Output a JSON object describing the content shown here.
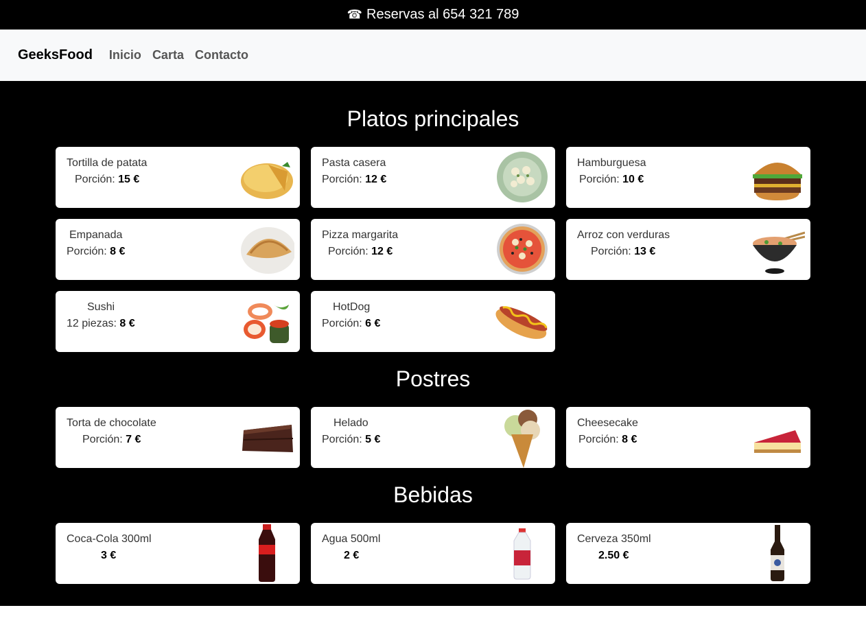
{
  "topbar": {
    "phone_icon": "☎",
    "text": "Reservas al 654 321 789"
  },
  "nav": {
    "brand": "GeeksFood",
    "links": [
      "Inicio",
      "Carta",
      "Contacto"
    ]
  },
  "sections": [
    {
      "title": "Platos principales",
      "items": [
        {
          "name": "Tortilla de patata",
          "price_label": "Porción:",
          "price": "15 €",
          "icon": "tortilla-image"
        },
        {
          "name": "Pasta casera",
          "price_label": "Porción:",
          "price": "12 €",
          "icon": "pasta-image"
        },
        {
          "name": "Hamburguesa",
          "price_label": "Porción:",
          "price": "10 €",
          "icon": "burger-image"
        },
        {
          "name": "Empanada",
          "price_label": "Porción:",
          "price": "8 €",
          "icon": "empanada-image"
        },
        {
          "name": "Pizza margarita",
          "price_label": "Porción:",
          "price": "12 €",
          "icon": "pizza-image"
        },
        {
          "name": "Arroz con verduras",
          "price_label": "Porción:",
          "price": "13 €",
          "icon": "rice-image"
        },
        {
          "name": "Sushi",
          "price_label": "12 piezas:",
          "price": "8 €",
          "icon": "sushi-image"
        },
        {
          "name": "HotDog",
          "price_label": "Porción:",
          "price": "6 €",
          "icon": "hotdog-image"
        }
      ]
    },
    {
      "title": "Postres",
      "items": [
        {
          "name": "Torta de chocolate",
          "price_label": "Porción:",
          "price": "7 €",
          "icon": "cake-image"
        },
        {
          "name": "Helado",
          "price_label": "Porción:",
          "price": "5 €",
          "icon": "icecream-image"
        },
        {
          "name": "Cheesecake",
          "price_label": "Porción:",
          "price": "8 €",
          "icon": "cheesecake-image"
        }
      ]
    },
    {
      "title": "Bebidas",
      "items": [
        {
          "name": "Coca-Cola 300ml",
          "price_label": "",
          "price": "3 €",
          "icon": "cola-bottle-image"
        },
        {
          "name": "Agua 500ml",
          "price_label": "",
          "price": "2 €",
          "icon": "water-bottle-image"
        },
        {
          "name": "Cerveza 350ml",
          "price_label": "",
          "price": "2.50 €",
          "icon": "beer-bottle-image"
        }
      ]
    }
  ]
}
